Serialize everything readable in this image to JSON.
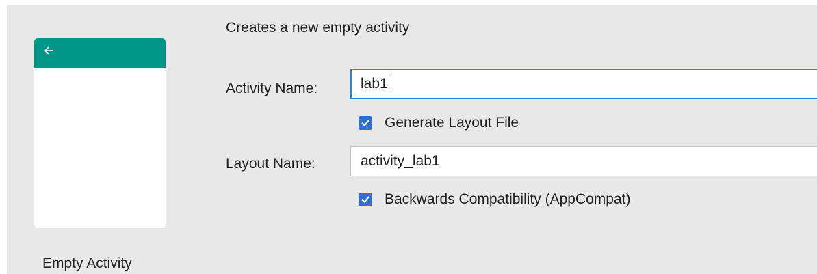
{
  "template": {
    "name": "Empty Activity",
    "accent_color": "#009688"
  },
  "form": {
    "description": "Creates a new empty activity",
    "activity_name": {
      "label": "Activity Name:",
      "value": "lab1"
    },
    "generate_layout": {
      "label": "Generate Layout File",
      "checked": true
    },
    "layout_name": {
      "label": "Layout Name:",
      "value": "activity_lab1"
    },
    "backwards_compat": {
      "label": "Backwards Compatibility (AppCompat)",
      "checked": true
    }
  },
  "colors": {
    "focus_border": "#2d7fd3",
    "checkbox": "#2f6fd1",
    "panel_bg": "#e8e8e8"
  }
}
